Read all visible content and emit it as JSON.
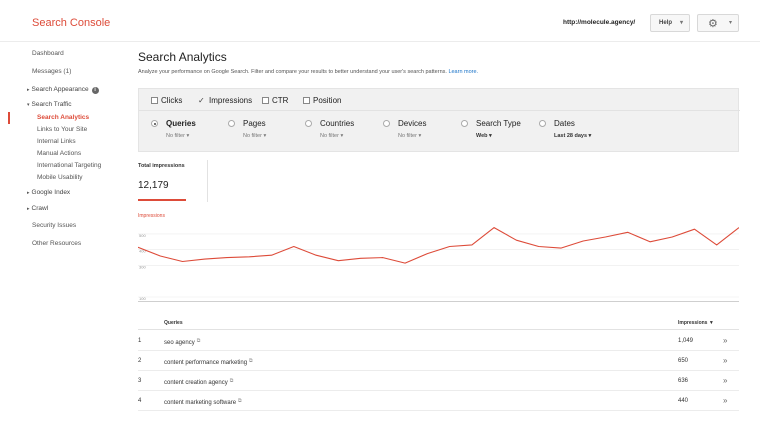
{
  "header": {
    "brand": "Search Console",
    "site_url": "http://molecule.agency/",
    "help_label": "Help",
    "caret": "▾",
    "gear_icon": "gear-icon"
  },
  "sidebar": {
    "dashboard": "Dashboard",
    "messages": "Messages (1)",
    "search_appearance": "Search Appearance",
    "search_traffic": "Search Traffic",
    "search_analytics": "Search Analytics",
    "links_to_site": "Links to Your Site",
    "internal_links": "Internal Links",
    "manual_actions": "Manual Actions",
    "international_targeting": "International Targeting",
    "mobile_usability": "Mobile Usability",
    "google_index": "Google Index",
    "crawl": "Crawl",
    "security_issues": "Security Issues",
    "other_resources": "Other Resources",
    "info_glyph": "i",
    "tri_right": "▸",
    "tri_down": "▾"
  },
  "main": {
    "title": "Search Analytics",
    "subtitle": "Analyze your performance on Google Search. Filter and compare your results to better understand your user's search patterns.",
    "learn_more": "Learn more."
  },
  "metrics": {
    "clicks": "Clicks",
    "impressions": "Impressions",
    "ctr": "CTR",
    "position": "Position",
    "check_glyph": "✓"
  },
  "groups": {
    "queries": {
      "label": "Queries",
      "sub": "No filter ▾"
    },
    "pages": {
      "label": "Pages",
      "sub": "No filter ▾"
    },
    "countries": {
      "label": "Countries",
      "sub": "No filter ▾"
    },
    "devices": {
      "label": "Devices",
      "sub": "No filter ▾"
    },
    "search_type": {
      "label": "Search Type",
      "sub": "Web ▾"
    },
    "dates": {
      "label": "Dates",
      "sub": "Last 28 days ▾"
    }
  },
  "totals": {
    "label": "Total impressions",
    "value": "12,179"
  },
  "chart_data": {
    "type": "line",
    "series": [
      {
        "name": "Impressions",
        "values": [
          415,
          360,
          325,
          340,
          350,
          355,
          365,
          420,
          365,
          330,
          345,
          350,
          315,
          375,
          420,
          430,
          540,
          460,
          420,
          410,
          455,
          480,
          510,
          450,
          480,
          530,
          430,
          540
        ]
      }
    ],
    "ylim": [
      100,
      550
    ],
    "yticks": [
      100,
      300,
      400,
      500
    ],
    "ytick_labels": [
      "100",
      "300",
      "400",
      "500"
    ],
    "ylabel": "Impressions",
    "grid": true,
    "color": "#dd4b39"
  },
  "table": {
    "col_queries": "Queries",
    "col_impressions": "Impressions ▼",
    "ext_glyph": "⧉",
    "go_glyph": "»",
    "rows": [
      {
        "num": "1",
        "query": "seo agency",
        "impressions": "1,049"
      },
      {
        "num": "2",
        "query": "content performance marketing",
        "impressions": "650"
      },
      {
        "num": "3",
        "query": "content creation agency",
        "impressions": "636"
      },
      {
        "num": "4",
        "query": "content marketing software",
        "impressions": "440"
      }
    ]
  }
}
